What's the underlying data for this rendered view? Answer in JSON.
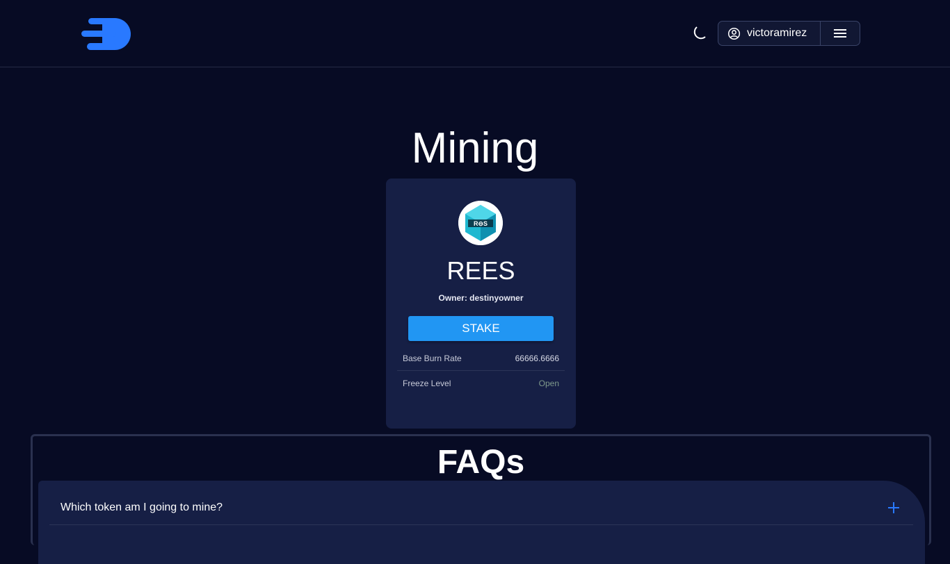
{
  "header": {
    "username": "victoramirez",
    "icons": {
      "logo": "brand-logo",
      "theme": "moon-icon",
      "user": "account-circle-icon",
      "menu": "hamburger-menu-icon"
    }
  },
  "page": {
    "title": "Mining"
  },
  "card": {
    "token_logo_text": "R⊖S",
    "token_name": "REES",
    "owner": "Owner: destinyowner",
    "stake_label": "STAKE",
    "stats": [
      {
        "label": "Base Burn Rate",
        "value": "66666.6666"
      },
      {
        "label": "Freeze Level",
        "value": "Open"
      }
    ]
  },
  "faq": {
    "title": "FAQs",
    "items": [
      {
        "question": "Which token am I going to mine?"
      }
    ]
  },
  "colors": {
    "background": "#070b24",
    "card": "#161f45",
    "accent": "#2196f3",
    "logo_blue": "#2979ff",
    "status_open": "#7f9a8c"
  }
}
